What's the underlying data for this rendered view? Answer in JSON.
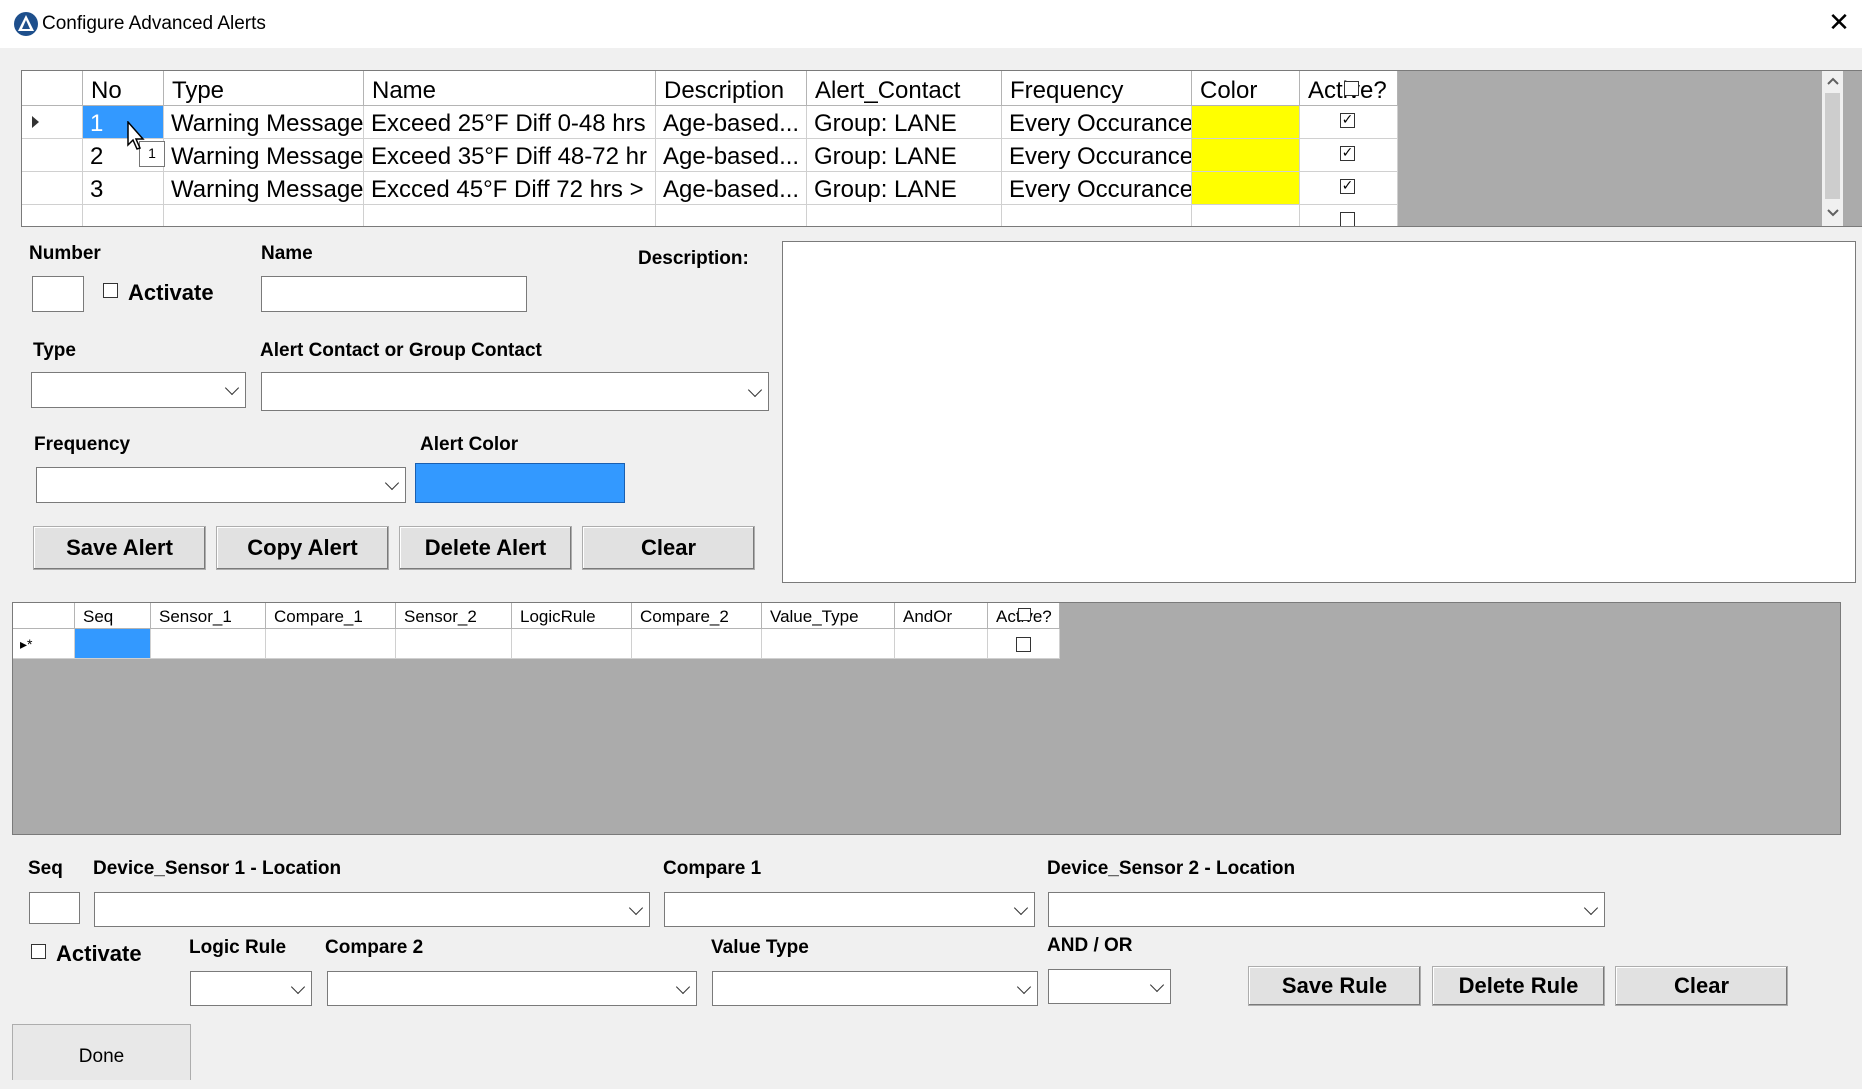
{
  "window": {
    "title": "Configure Advanced Alerts",
    "close_glyph": "✕"
  },
  "alerts_grid": {
    "columns": [
      "No",
      "Type",
      "Name",
      "Description",
      "Alert_Contact",
      "Frequency",
      "Color",
      "Active?"
    ],
    "rows": [
      {
        "no": "1",
        "type": "Warning Message",
        "name": "Exceed 25°F Diff 0-48 hrs",
        "description": "Age-based...",
        "contact": "Group: LANE",
        "frequency": "Every Occurance",
        "color": "#ffff00",
        "active": true
      },
      {
        "no": "2",
        "type": "Warning Message",
        "name": "Exceed 35°F Diff 48-72 hr",
        "description": "Age-based...",
        "contact": "Group: LANE",
        "frequency": "Every Occurance",
        "color": "#ffff00",
        "active": true
      },
      {
        "no": "3",
        "type": "Warning Message",
        "name": "Excced 45°F Diff 72 hrs >",
        "description": "Age-based...",
        "contact": "Group: LANE",
        "frequency": "Every Occurance",
        "color": "#ffff00",
        "active": true
      }
    ],
    "tooltip": "1"
  },
  "alert_form": {
    "number_label": "Number",
    "name_label": "Name",
    "description_label": "Description:",
    "activate_label": "Activate",
    "type_label": "Type",
    "contact_label": "Alert Contact or Group Contact",
    "frequency_label": "Frequency",
    "alert_color_label": "Alert Color",
    "alert_color_value": "#3399ff",
    "save_button": "Save Alert",
    "copy_button": "Copy Alert",
    "delete_button": "Delete Alert",
    "clear_button": "Clear"
  },
  "rules_grid": {
    "columns": [
      "Seq",
      "Sensor_1",
      "Compare_1",
      "Sensor_2",
      "LogicRule",
      "Compare_2",
      "Value_Type",
      "AndOr",
      "Active?"
    ],
    "new_row_marker": "▸*"
  },
  "rule_form": {
    "seq_label": "Seq",
    "sensor1_label": "Device_Sensor 1 - Location",
    "compare1_label": "Compare 1",
    "sensor2_label": "Device_Sensor 2 - Location",
    "activate_label": "Activate",
    "logic_rule_label": "Logic Rule",
    "compare2_label": "Compare 2",
    "value_type_label": "Value Type",
    "andor_label": "AND / OR",
    "save_button": "Save Rule",
    "delete_button": "Delete Rule",
    "clear_button": "Clear"
  },
  "footer": {
    "done_button": "Done"
  },
  "colors": {
    "grid_background": "#ababab",
    "selection": "#3399ff",
    "row_highlight_color": "#ffff00"
  }
}
